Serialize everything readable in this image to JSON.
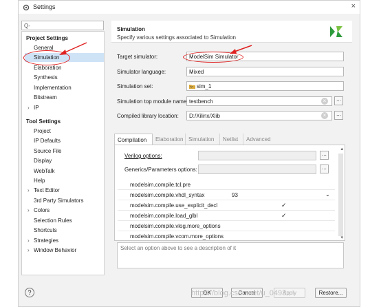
{
  "window": {
    "title": "Settings",
    "close": "×"
  },
  "search": {
    "placeholder": "Q-"
  },
  "tree": {
    "project_header": "Project Settings",
    "project_items": [
      "General",
      "Simulation",
      "Elaboration",
      "Synthesis",
      "Implementation",
      "Bitstream",
      "IP"
    ],
    "tool_header": "Tool Settings",
    "tool_items": [
      "Project",
      "IP Defaults",
      "Source File",
      "Display",
      "WebTalk",
      "Help",
      "Text Editor",
      "3rd Party Simulators",
      "Colors",
      "Selection Rules",
      "Shortcuts",
      "Strategies",
      "Window Behavior"
    ]
  },
  "panel": {
    "title": "Simulation",
    "subtitle": "Specify various settings associated to Simulation"
  },
  "fields": {
    "target_sim_label": "Target simulator:",
    "target_sim_value": "ModelSim Simulator",
    "sim_lang_label": "Simulator language:",
    "sim_lang_value": "Mixed",
    "sim_set_label": "Simulation set:",
    "sim_set_value": "sim_1",
    "top_module_label": "Simulation top module name:",
    "top_module_value": "testbench",
    "lib_loc_label": "Compiled library location:",
    "lib_loc_value": "D:/Xilinx/Xlib"
  },
  "tabs": [
    "Compilation",
    "Elaboration",
    "Simulation",
    "Netlist",
    "Advanced"
  ],
  "compilation": {
    "verilog_label": "Verilog options:",
    "generics_label": "Generics/Parameters options:",
    "props": [
      {
        "key": "modelsim.compile.tcl.pre",
        "value": "",
        "checked": false
      },
      {
        "key": "modelsim.compile.vhdl_syntax",
        "value": "93",
        "checked": false
      },
      {
        "key": "modelsim.compile.use_explicit_decl",
        "value": "",
        "checked": true
      },
      {
        "key": "modelsim.compile.load_glbl",
        "value": "",
        "checked": true
      },
      {
        "key": "modelsim.compile.vlog.more_options",
        "value": "",
        "checked": false
      },
      {
        "key": "modelsim.compile.vcom.more_options",
        "value": "",
        "checked": false
      }
    ]
  },
  "description": "Select an option above to see a description of it",
  "buttons": {
    "help": "?",
    "ok": "OK",
    "cancel": "Cancel",
    "apply": "Apply",
    "restore": "Restore..."
  },
  "watermark": "https://blog.csdn.net/u_0493",
  "colors": {
    "selection": "#cfe3f7",
    "annotation": "#e02020",
    "logo": "#2d9a3c"
  }
}
